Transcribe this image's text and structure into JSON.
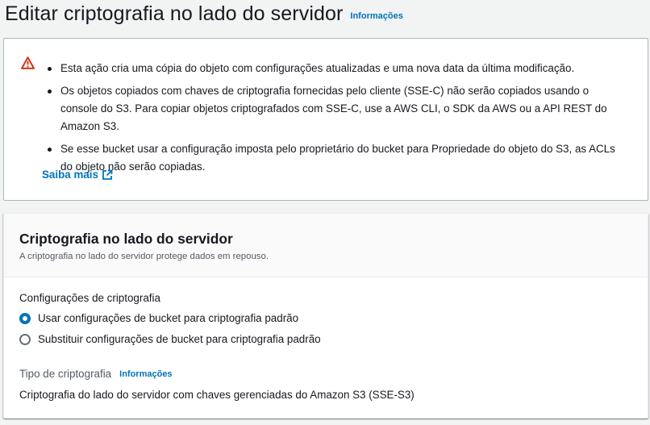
{
  "header": {
    "title": "Editar criptografia no lado do servidor",
    "info_label": "Informações"
  },
  "warning": {
    "icon": "warning-triangle-icon",
    "icon_color": "#d13212",
    "items": [
      "Esta ação cria uma cópia do objeto com configurações atualizadas e uma nova data da última modificação.",
      "Os objetos copiados com chaves de criptografia fornecidas pelo cliente (SSE-C) não serão copiados usando o console do S3. Para copiar objetos criptografados com SSE-C, use a AWS CLI, o SDK da AWS ou a API REST do Amazon S3.",
      "Se esse bucket usar a configuração imposta pelo proprietário do bucket para Propriedade do objeto do S3, as ACLs do objeto não serão copiadas."
    ],
    "learn_more_label": "Saiba mais",
    "learn_more_icon": "external-link-icon"
  },
  "panel": {
    "title": "Criptografia no lado do servidor",
    "description": "A criptografia no lado do servidor protege dados em repouso.",
    "settings_label": "Configurações de criptografia",
    "options": [
      {
        "label": "Usar configurações de bucket para criptografia padrão",
        "checked": true
      },
      {
        "label": "Substituir configurações de bucket para criptografia padrão",
        "checked": false
      }
    ],
    "type_label": "Tipo de criptografia",
    "type_info_label": "Informações",
    "type_value": "Criptografia do lado do servidor com chaves gerenciadas do Amazon S3 (SSE-S3)"
  },
  "colors": {
    "link": "#0073bb",
    "accent_radio": "#0073bb",
    "background": "#f2f3f3"
  }
}
